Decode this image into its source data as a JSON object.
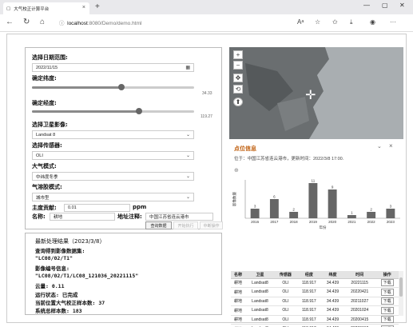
{
  "browser": {
    "tab_title": "大气校正计算平台",
    "url_host": "localhost",
    "url_path": ":8080/Demo/demo.html"
  },
  "form": {
    "date_label": "选择日期范围:",
    "date_value": "2022/11/15",
    "lat_label": "确定纬度:",
    "lat_value": "34.33",
    "lat_fraction": 0.55,
    "lon_label": "确定经度:",
    "lon_value": "119.27",
    "lon_fraction": 0.66,
    "satellite_label": "选择卫星影像:",
    "satellite_value": "Landsat 8",
    "sensor_label": "选择传感器:",
    "sensor_value": "OLI",
    "atmos_label": "大气模式:",
    "atmos_value": "中纬度冬季",
    "aerosol_label": "气溶胶模式:",
    "aerosol_value": "城市型",
    "contribution_label": "主度贡献:",
    "contribution_value": "0.01",
    "contribution_unit": "ppm",
    "name_label": "名称:",
    "name_value": "耕地",
    "address_label": "地址注释:",
    "address_value": "中国江苏省连云港市",
    "btn_query": "查询数据",
    "btn_start": "开始执行",
    "btn_stop": "中断操作"
  },
  "map": {
    "zoom_in": "+",
    "zoom_out": "−",
    "info_title": "点位信息",
    "info_text": "位于：中国江苏省连云港市，更新时间：2022/3/8 17:00."
  },
  "chart_data": {
    "type": "bar",
    "categories": [
      "2016",
      "2017",
      "2018",
      "2019",
      "2020",
      "2021",
      "2022",
      "2023"
    ],
    "values": [
      3,
      6,
      2,
      11,
      9,
      1,
      2,
      3
    ],
    "title": "",
    "xlabel": "年份",
    "ylabel": "影像数量",
    "ylim": [
      0,
      12
    ],
    "grid": false
  },
  "results": {
    "title": "最新处理结果（2023/3/8）",
    "line1": "查询得到影像数据集:",
    "line2": "\"LC08/02/T1\"",
    "line3": "影像编号信息:",
    "line4": "\"LC08/02/T1/LC08_121036_20221115\"",
    "line5": "云量: 0.11",
    "line6": "运行状态: 已完成",
    "line7": "当前位置大气校正样本数: 37",
    "line8": "系统总样本数: 183"
  },
  "table": {
    "headers": [
      "名称",
      "卫星",
      "传感器",
      "经度",
      "纬度",
      "时间",
      "操作"
    ],
    "rows": [
      [
        "耕地",
        "Landsat8",
        "OLI",
        "118.917",
        "34.439",
        "20221115",
        "下载"
      ],
      [
        "耕地",
        "Landsat8",
        "OLI",
        "118.917",
        "34.439",
        "20220421",
        "下载"
      ],
      [
        "耕地",
        "Landsat8",
        "OLI",
        "118.917",
        "34.439",
        "20211027",
        "下载"
      ],
      [
        "耕地",
        "Landsat8",
        "OLI",
        "118.917",
        "34.439",
        "20201024",
        "下载"
      ],
      [
        "耕地",
        "Landsat8",
        "OLI",
        "118.917",
        "34.439",
        "20200415",
        "下载"
      ],
      [
        "耕地",
        "Landsat8",
        "OLI",
        "118.917",
        "34.439",
        "20200312",
        "下载"
      ]
    ]
  }
}
